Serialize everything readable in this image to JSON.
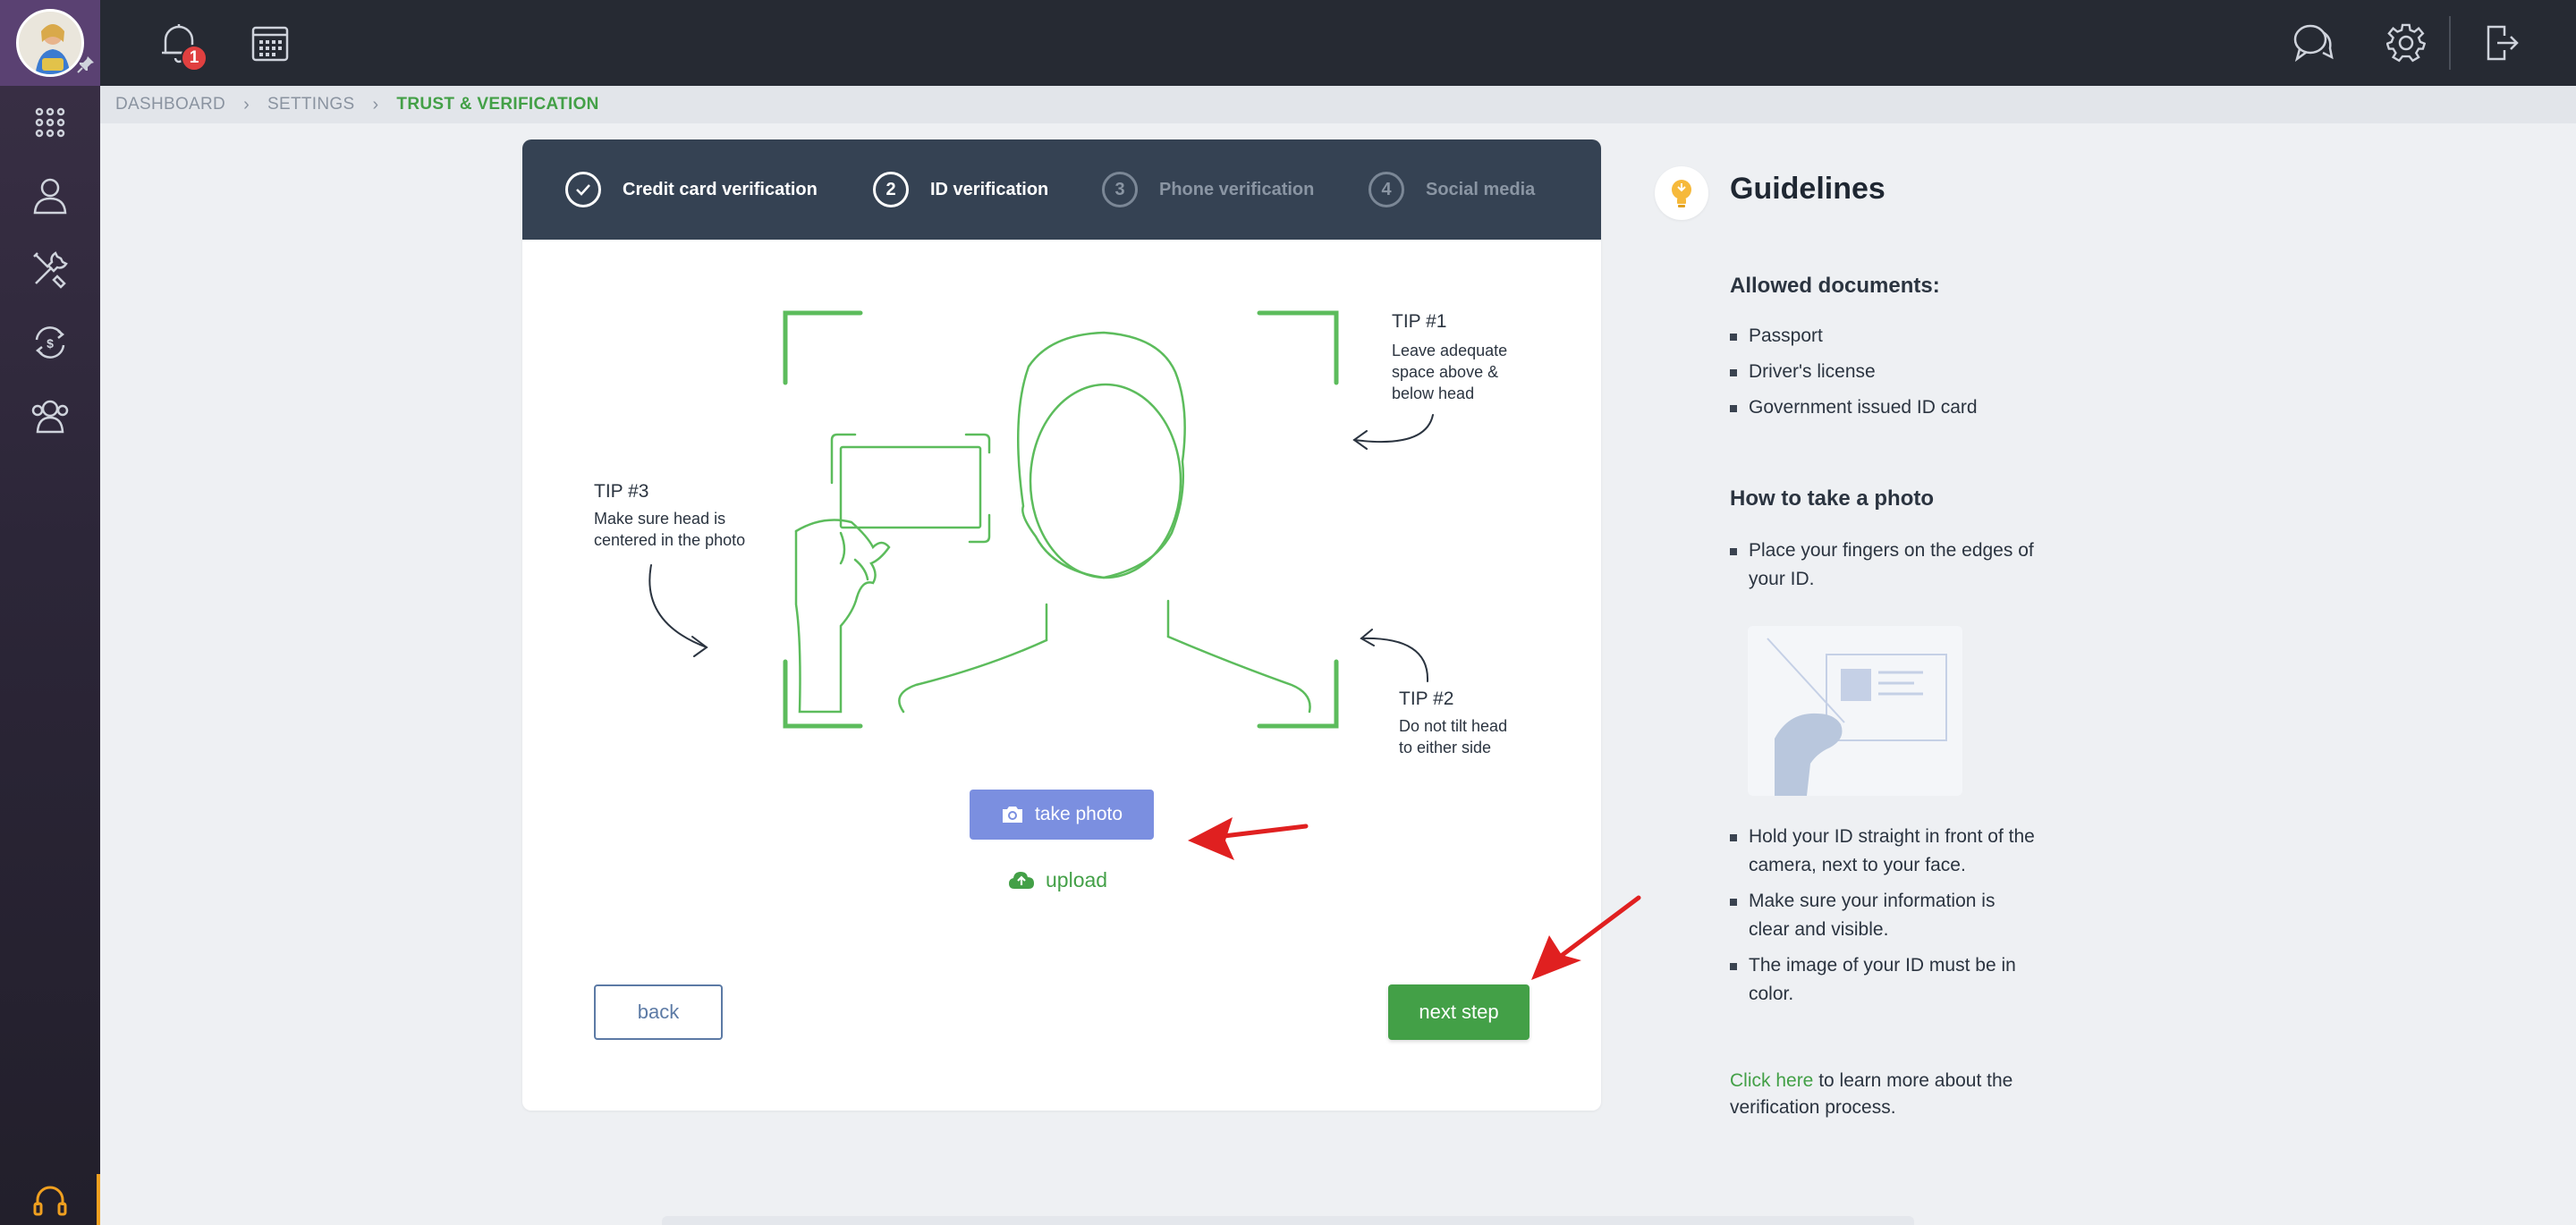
{
  "topbar": {
    "notification_count": "1"
  },
  "breadcrumb": {
    "items": [
      "DASHBOARD",
      "SETTINGS",
      "TRUST & VERIFICATION"
    ]
  },
  "stepper": {
    "steps": [
      {
        "number": "",
        "label": "Credit card verification",
        "state": "completed"
      },
      {
        "number": "2",
        "label": "ID verification",
        "state": "active"
      },
      {
        "number": "3",
        "label": "Phone verification",
        "state": "inactive"
      },
      {
        "number": "4",
        "label": "Social media",
        "state": "inactive"
      }
    ]
  },
  "tips": {
    "tip1": {
      "title": "TIP #1",
      "lines": [
        "Leave adequate",
        "space above &",
        "below head"
      ]
    },
    "tip2": {
      "title": "TIP #2",
      "lines": [
        "Do not tilt head",
        "to either side"
      ]
    },
    "tip3": {
      "title": "TIP #3",
      "lines": [
        "Make sure head is",
        "centered in the photo"
      ]
    }
  },
  "actions": {
    "take_photo": "take photo",
    "upload": "upload",
    "back": "back",
    "next_step": "next step"
  },
  "guidelines": {
    "title": "Guidelines",
    "allowed_title": "Allowed documents:",
    "allowed": [
      "Passport",
      "Driver's license",
      "Government issued ID card"
    ],
    "howto_title": "How to take a photo",
    "howto_first": [
      "Place your fingers on the edges of",
      "your ID."
    ],
    "howto_rest": [
      [
        "Hold your ID straight in front of the",
        "camera, next to your face."
      ],
      [
        "Make sure your information is",
        "clear and visible."
      ],
      [
        "The image of your ID must be in",
        "color."
      ]
    ],
    "footer_link": "Click here",
    "footer_text": " to learn more about the verification process."
  },
  "colors": {
    "accent_green": "#43a047",
    "stepper_bg": "#354253",
    "take_photo_blue": "#7b8fe0",
    "annotation_red": "#e02020",
    "badge_red": "#e04040"
  },
  "icons": [
    "bell-icon",
    "calendar-icon",
    "chat-icon",
    "gear-icon",
    "logout-icon",
    "apps-grid-icon",
    "user-icon",
    "tools-icon",
    "billing-icon",
    "team-icon",
    "headset-icon",
    "camera-icon",
    "cloud-upload-icon",
    "bulb-icon",
    "check-icon"
  ]
}
